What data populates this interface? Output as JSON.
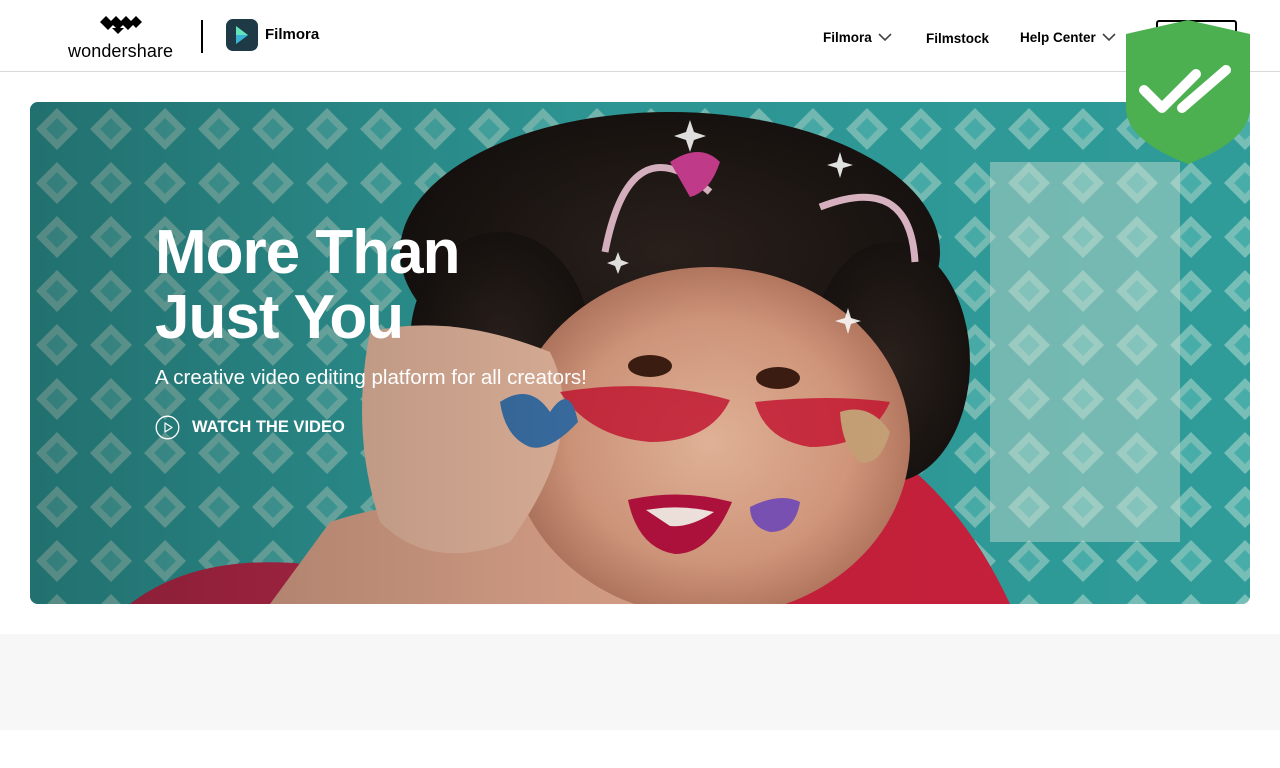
{
  "header": {
    "brand": "wondershare",
    "product": "Filmora",
    "nav": [
      {
        "label": "Filmora",
        "has_dropdown": true
      },
      {
        "label": "Filmstock",
        "has_dropdown": false
      },
      {
        "label": "Help Center",
        "has_dropdown": true
      }
    ]
  },
  "hero": {
    "title_line1": "More Than",
    "title_line2": "Just You",
    "subtitle": "A creative video editing platform for all creators!",
    "cta_label": "WATCH THE VIDEO",
    "cta_icon": "play-circle-icon"
  },
  "overlay": {
    "badge_icon": "shield-double-check-icon",
    "badge_color": "#4caf50"
  },
  "colors": {
    "hero_bg": "#3aa5a4",
    "nav_text": "#000000",
    "hero_text": "#ffffff",
    "band_bg": "#f7f7f7"
  }
}
